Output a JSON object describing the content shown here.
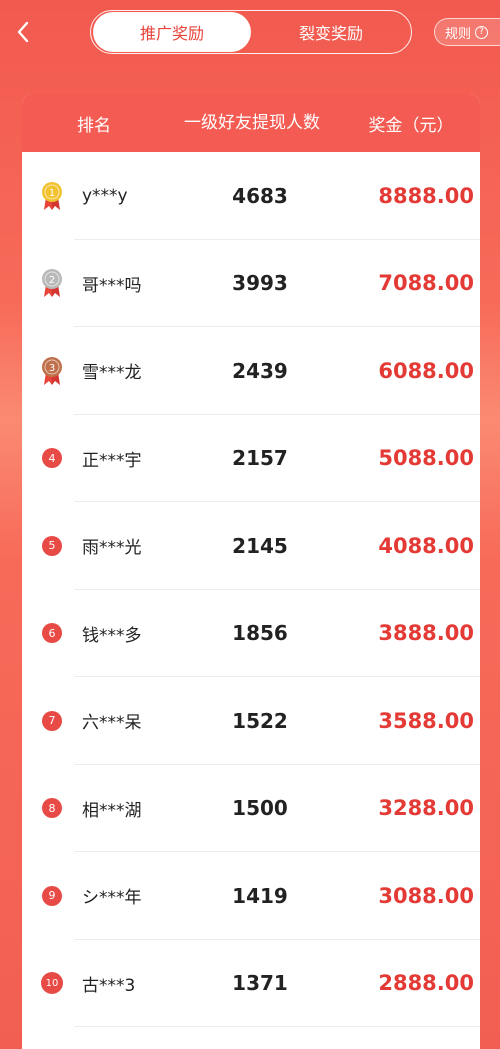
{
  "header": {
    "tabs": [
      {
        "label": "推广奖励",
        "active": true
      },
      {
        "label": "裂变奖励",
        "active": false
      }
    ],
    "rules_label": "规则",
    "rules_icon": "question-icon"
  },
  "table": {
    "columns": {
      "rank": "排名",
      "count": "一级好友提现人数",
      "prize": "奖金（元）"
    },
    "rows": [
      {
        "rank": "1",
        "name": "y***y",
        "count": "4683",
        "prize": "8888.00",
        "badge": "gold-medal"
      },
      {
        "rank": "2",
        "name": "哥***吗",
        "count": "3993",
        "prize": "7088.00",
        "badge": "silver-medal"
      },
      {
        "rank": "3",
        "name": "雪***龙",
        "count": "2439",
        "prize": "6088.00",
        "badge": "bronze-medal"
      },
      {
        "rank": "4",
        "name": "正***宇",
        "count": "2157",
        "prize": "5088.00",
        "badge": "number"
      },
      {
        "rank": "5",
        "name": "雨***光",
        "count": "2145",
        "prize": "4088.00",
        "badge": "number"
      },
      {
        "rank": "6",
        "name": "钱***多",
        "count": "1856",
        "prize": "3888.00",
        "badge": "number"
      },
      {
        "rank": "7",
        "name": "六***呆",
        "count": "1522",
        "prize": "3588.00",
        "badge": "number"
      },
      {
        "rank": "8",
        "name": "相***湖",
        "count": "1500",
        "prize": "3288.00",
        "badge": "number"
      },
      {
        "rank": "9",
        "name": "シ***年",
        "count": "1419",
        "prize": "3088.00",
        "badge": "number"
      },
      {
        "rank": "10",
        "name": "古***3",
        "count": "1371",
        "prize": "2888.00",
        "badge": "number"
      }
    ]
  },
  "colors": {
    "accent": "#e43a36",
    "header_bg": "#f45b52",
    "gold": "#f2c230",
    "silver": "#b9b9b9",
    "bronze": "#c0704a"
  }
}
